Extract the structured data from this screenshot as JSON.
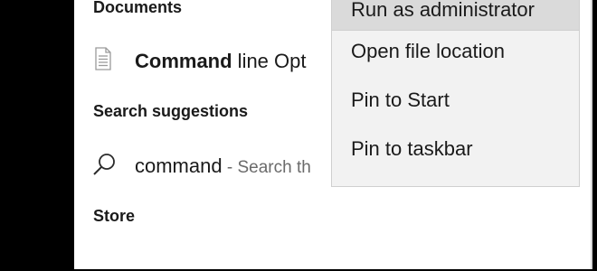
{
  "sections": {
    "documents_heading": "Documents",
    "search_suggestions_heading": "Search suggestions",
    "store_heading": "Store"
  },
  "document_result": {
    "bold_text": "Command",
    "rest_text": " line Opt",
    "icon": "document-icon"
  },
  "suggestion_result": {
    "query": "command",
    "hint": " - Search th",
    "icon": "search-icon"
  },
  "context_menu": {
    "items": [
      {
        "label": "Run as administrator"
      },
      {
        "label": "Open file location"
      },
      {
        "label": "Pin to Start"
      },
      {
        "label": "Pin to taskbar"
      }
    ]
  },
  "colors": {
    "menu_background": "#f2f2f2",
    "menu_highlight": "#dadada",
    "left_bar": "#000000"
  }
}
